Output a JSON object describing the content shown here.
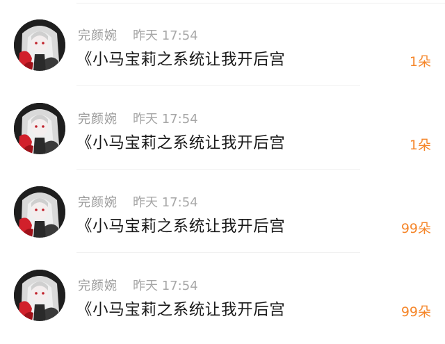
{
  "items": [
    {
      "user": "完颜婉",
      "time": "昨天 17:54",
      "message": "《小马宝莉之系统让我开后宫",
      "gift": "1朵",
      "avatar_icon": "anime-avatar-icon"
    },
    {
      "user": "完颜婉",
      "time": "昨天 17:54",
      "message": "《小马宝莉之系统让我开后宫",
      "gift": "1朵",
      "avatar_icon": "anime-avatar-icon"
    },
    {
      "user": "完颜婉",
      "time": "昨天 17:54",
      "message": "《小马宝莉之系统让我开后宫",
      "gift": "99朵",
      "avatar_icon": "anime-avatar-icon"
    },
    {
      "user": "完颜婉",
      "time": "昨天 17:54",
      "message": "《小马宝莉之系统让我开后宫",
      "gift": "99朵",
      "avatar_icon": "anime-avatar-icon"
    }
  ],
  "colors": {
    "gift": "#f5862a",
    "meta": "#9a9a9a",
    "text": "#1a1a1a"
  }
}
